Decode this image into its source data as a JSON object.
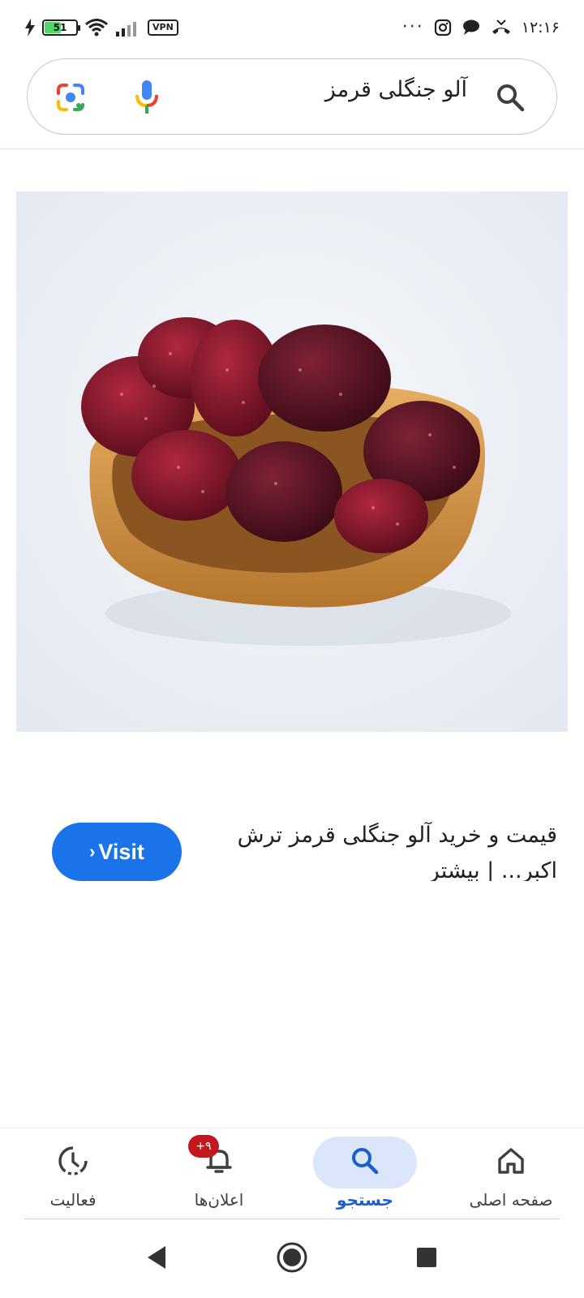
{
  "status_bar": {
    "time": "۱۲:۱۶",
    "battery_level": "51",
    "battery_fraction": 0.51,
    "vpn_label": "VPN",
    "more_dots": "···"
  },
  "search": {
    "query": "آلو جنگلی قرمز"
  },
  "result": {
    "title": "قیمت و خرید آلو جنگلی قرمز ترش اکبر... | بیشتر",
    "visit_label": "Visit",
    "visit_arrow": "›"
  },
  "bottom_nav": {
    "items": [
      {
        "label": "صفحه اصلی",
        "icon": "home-icon"
      },
      {
        "label": "جستجو",
        "icon": "search-icon",
        "active": true
      },
      {
        "label": "اعلان‌ها",
        "icon": "bell-icon",
        "badge": "۹+"
      },
      {
        "label": "فعالیت",
        "icon": "activity-icon"
      }
    ]
  },
  "colors": {
    "accent": "#1a73e8",
    "active_pill": "#dce6fb",
    "badge": "#c4181f"
  }
}
